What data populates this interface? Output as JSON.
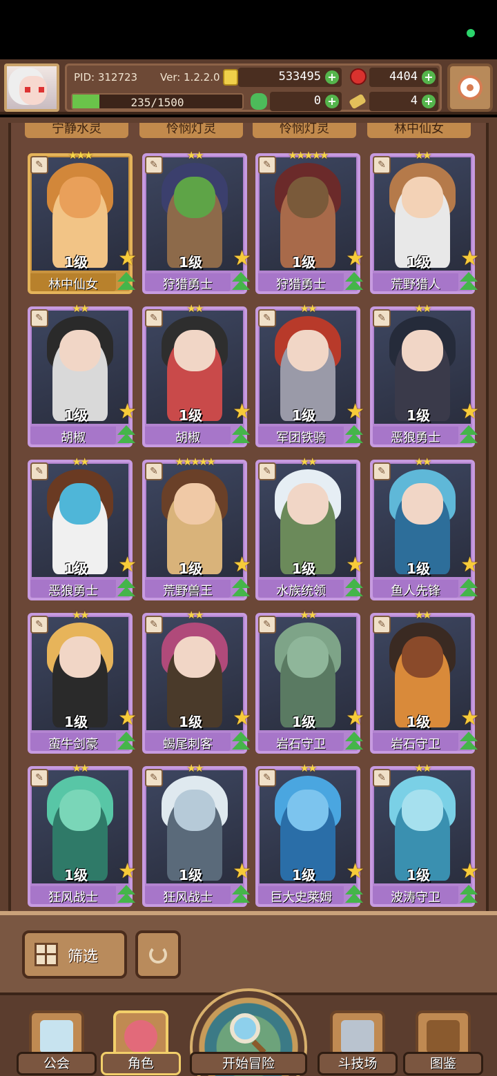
{
  "status": {},
  "header": {
    "pid": "PID: 312723",
    "version": "Ver: 1.2.2.0",
    "gold": "533495",
    "gems": "4404",
    "clover": "0",
    "keys": "4",
    "xp_text": "235/1500",
    "xp_progress": 0.157
  },
  "partial_row": [
    "宁静水灵",
    "怜悯灯灵",
    "怜悯灯灵",
    "林中仙女"
  ],
  "cards": [
    {
      "name": "林中仙女",
      "level": "1级",
      "stars": 3,
      "rarity": "gold",
      "palette": [
        "#d2873a",
        "#e9a05a",
        "#f2c486"
      ]
    },
    {
      "name": "狩猎勇士",
      "level": "1级",
      "stars": 2,
      "rarity": "purple",
      "palette": [
        "#3b3f6d",
        "#5ea447",
        "#8d6a4a"
      ]
    },
    {
      "name": "狩猎勇士",
      "level": "1级",
      "stars": 5,
      "rarity": "purple",
      "palette": [
        "#6b2a2a",
        "#7a5a3a",
        "#a86a4a"
      ]
    },
    {
      "name": "荒野猎人",
      "level": "1级",
      "stars": 2,
      "rarity": "purple",
      "palette": [
        "#b57a4a",
        "#f3d2b6",
        "#e8e8e8"
      ]
    },
    {
      "name": "胡椒",
      "level": "1级",
      "stars": 2,
      "rarity": "purple",
      "palette": [
        "#2a2a2a",
        "#f1d6c6",
        "#d9d9d9"
      ]
    },
    {
      "name": "胡椒",
      "level": "1级",
      "stars": 2,
      "rarity": "purple",
      "palette": [
        "#2e2e2e",
        "#f1d6c6",
        "#c94a4a"
      ]
    },
    {
      "name": "军团铁骑",
      "level": "1级",
      "stars": 2,
      "rarity": "purple",
      "palette": [
        "#b83a2a",
        "#f1d6c6",
        "#9a9aa8"
      ]
    },
    {
      "name": "恶狼勇士",
      "level": "1级",
      "stars": 2,
      "rarity": "purple",
      "palette": [
        "#252b3a",
        "#f1d6c6",
        "#3a3a4a"
      ]
    },
    {
      "name": "恶狼勇士",
      "level": "1级",
      "stars": 2,
      "rarity": "purple",
      "palette": [
        "#6a3a22",
        "#4fb6d8",
        "#f0f0f0"
      ]
    },
    {
      "name": "荒野兽王",
      "level": "1级",
      "stars": 5,
      "rarity": "purple",
      "palette": [
        "#6a4028",
        "#f0c9a6",
        "#d9b37a"
      ]
    },
    {
      "name": "水族统领",
      "level": "1级",
      "stars": 2,
      "rarity": "purple",
      "palette": [
        "#e6eef4",
        "#f1d6c6",
        "#6b8a5a"
      ]
    },
    {
      "name": "鱼人先锋",
      "level": "1级",
      "stars": 2,
      "rarity": "purple",
      "palette": [
        "#5fb8d8",
        "#f1d6c6",
        "#2d6e9a"
      ]
    },
    {
      "name": "蛮牛剑豪",
      "level": "1级",
      "stars": 2,
      "rarity": "purple",
      "palette": [
        "#e7b45a",
        "#f1d6c6",
        "#2a2a2a"
      ]
    },
    {
      "name": "蝎尾刺客",
      "level": "1级",
      "stars": 2,
      "rarity": "purple",
      "palette": [
        "#b04a7a",
        "#f1d6c6",
        "#4a3a2a"
      ]
    },
    {
      "name": "岩石守卫",
      "level": "1级",
      "stars": 2,
      "rarity": "purple",
      "palette": [
        "#7ea488",
        "#8fb69a",
        "#5a7a62"
      ]
    },
    {
      "name": "岩石守卫",
      "level": "1级",
      "stars": 2,
      "rarity": "purple",
      "palette": [
        "#3a2a22",
        "#8a4a2a",
        "#d98a3a"
      ]
    },
    {
      "name": "狂风战士",
      "level": "1级",
      "stars": 2,
      "rarity": "purple",
      "palette": [
        "#58c6a6",
        "#7ad6b8",
        "#2f7a68"
      ]
    },
    {
      "name": "狂风战士",
      "level": "1级",
      "stars": 2,
      "rarity": "purple",
      "palette": [
        "#dfe9ef",
        "#b6cad8",
        "#5a6a7a"
      ]
    },
    {
      "name": "巨大史莱姆",
      "level": "1级",
      "stars": 2,
      "rarity": "purple",
      "palette": [
        "#4aa6e0",
        "#7cc4ee",
        "#2a6ea8"
      ]
    },
    {
      "name": "波涛守卫",
      "level": "1级",
      "stars": 2,
      "rarity": "purple",
      "palette": [
        "#7ad0e6",
        "#a6e0ee",
        "#3a90b0"
      ]
    }
  ],
  "filter": {
    "label": "筛选"
  },
  "nav": {
    "guild": "公会",
    "character": "角色",
    "adventure": "开始冒险",
    "arena": "斗技场",
    "codex": "图鉴"
  }
}
